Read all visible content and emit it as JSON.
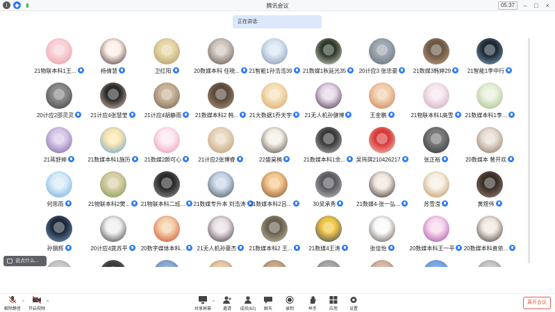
{
  "titlebar": {
    "title": "腾讯会议",
    "time": "05:37",
    "icons": [
      "info-icon",
      "shield-icon",
      "signal-icon"
    ]
  },
  "speaking": {
    "label": "正在讲话:"
  },
  "participants": [
    {
      "name": "21物联本科1王...",
      "c1": "#f9d2d8",
      "c2": "#e69aa6"
    },
    {
      "name": "杨倩慧",
      "c1": "#fdeee6",
      "c2": "#3c2a2a"
    },
    {
      "name": "卫红阳",
      "c1": "#e7d8a8",
      "c2": "#a89060"
    },
    {
      "name": "20数媒本科 任晓...",
      "c1": "#cfc7c0",
      "c2": "#5a4f4a"
    },
    {
      "name": "21智能1孙浩浩39",
      "c1": "#d9e6f2",
      "c2": "#7e8fa8"
    },
    {
      "name": "21数媒1秋延光35",
      "c1": "#2f3a2c",
      "c2": "#d8d8c8"
    },
    {
      "name": "20计应3 张忠豪",
      "c1": "#9ea8b0",
      "c2": "#5f6a72"
    },
    {
      "name": "21数媒3韩婷29",
      "c1": "#6b5846",
      "c2": "#c6a27c"
    },
    {
      "name": "21智能1李中行",
      "c1": "#1e2a36",
      "c2": "#8aa7c0"
    },
    {
      "name": "20计应2邵灵灵",
      "c1": "#8a8a8a",
      "c2": "#3e3e3e"
    },
    {
      "name": "21计应4张慧莹",
      "c1": "#2a2a2a",
      "c2": "#e6c7b6"
    },
    {
      "name": "21计应4胡静雨",
      "c1": "#c9b49a",
      "c2": "#6e5a46"
    },
    {
      "name": "21数媒本科2 韩...",
      "c1": "#5a4a3c",
      "c2": "#b89a7c"
    },
    {
      "name": "21大数据1乔天宇",
      "c1": "#f4e0b8",
      "c2": "#d8a060"
    },
    {
      "name": "21无人机孙健博",
      "c1": "#e6d8e8",
      "c2": "#3a2a3a"
    },
    {
      "name": "王金鹏",
      "c1": "#f2d0b0",
      "c2": "#c97a50"
    },
    {
      "name": "21物联本科1高雪",
      "c1": "#f6e6ee",
      "c2": "#caa0b8"
    },
    {
      "name": "21数媒本科1李...",
      "c1": "#e8f0dc",
      "c2": "#9ab880"
    },
    {
      "name": "21蒋舒婷",
      "c1": "#d8c8e8",
      "c2": "#7860a0"
    },
    {
      "name": "21数媒本科1施历",
      "c1": "#fbe6b0",
      "c2": "#5aa0d8"
    },
    {
      "name": "21数媒2颜可心",
      "c1": "#fbe8f0",
      "c2": "#e890b0"
    },
    {
      "name": "21计应2张博睿",
      "c1": "#e8d8c0",
      "c2": "#b89870"
    },
    {
      "name": "22盛昊楠",
      "c1": "#f4f0e8",
      "c2": "#4a4036"
    },
    {
      "name": "21数媒本科1余...",
      "c1": "#3a3a3a",
      "c2": "#bdbdbd"
    },
    {
      "name": "吴玮琪210426217",
      "c1": "#d83a3a",
      "c2": "#f0d0c0"
    },
    {
      "name": "张正裕",
      "c1": "#7a7a7a",
      "c2": "#2e2e2e"
    },
    {
      "name": "20数媒本 曾开欢",
      "c1": "#e6ddd4",
      "c2": "#8a6e5a"
    },
    {
      "name": "何思雨",
      "c1": "#d8ecf8",
      "c2": "#6aa6d8"
    },
    {
      "name": "21物联本科2樊...",
      "c1": "#d8d0a8",
      "c2": "#7a9048"
    },
    {
      "name": "21物联本科二班...",
      "c1": "#2a2a2a",
      "c2": "#9a9a9a"
    },
    {
      "name": "21数媒专升本 刘浩涛",
      "c1": "#c8d8e8",
      "c2": "#404850"
    },
    {
      "name": "21数媒本科2吕...",
      "c1": "#f4c890",
      "c2": "#7a4a28"
    },
    {
      "name": "30吴承秀",
      "c1": "#5a5a60",
      "c2": "#c0c0c8"
    },
    {
      "name": "21数媒4-张一弘...",
      "c1": "#f0e8e0",
      "c2": "#2a2020"
    },
    {
      "name": "苏雪滢",
      "c1": "#f6f0e4",
      "c2": "#b88850"
    },
    {
      "name": "黄煜伟",
      "c1": "#3a302a",
      "c2": "#a08070"
    },
    {
      "name": "孙钢辉",
      "c1": "#1e2a3a",
      "c2": "#7aa0c8"
    },
    {
      "name": "20计应4龚苏平",
      "c1": "#f0f0f0",
      "c2": "#303030"
    },
    {
      "name": "20数字媒体本科...",
      "c1": "#f4d0a8",
      "c2": "#c8402a"
    },
    {
      "name": "21无人机孙豪杰",
      "c1": "#e8e0e4",
      "c2": "#3a3036"
    },
    {
      "name": "21数媒本科2 王...",
      "c1": "#6a6050",
      "c2": "#c8c0a8"
    },
    {
      "name": "21数媒4王涛",
      "c1": "#f0c848",
      "c2": "#2a3a60"
    },
    {
      "name": "张佳怡",
      "c1": "#fafafa",
      "c2": "#5a4a40"
    },
    {
      "name": "20数媒本科王一平",
      "c1": "#f8d8ec",
      "c2": "#a040a0"
    },
    {
      "name": "20数媒本科袁依...",
      "c1": "#f0e8e0",
      "c2": "#3a3030"
    },
    {
      "name": "",
      "c1": "#c8c8c8",
      "c2": "#888888"
    },
    {
      "name": "",
      "c1": "#3a3a3a",
      "c2": "#888888"
    },
    {
      "name": "",
      "c1": "#8aaad8",
      "c2": "#3a5a8a"
    },
    {
      "name": "",
      "c1": "#e8c8a8",
      "c2": "#8a6a4a"
    },
    {
      "name": "",
      "c1": "#c8a888",
      "c2": "#6a4a2a"
    },
    {
      "name": "",
      "c1": "#a8a8a8",
      "c2": "#5a5a5a"
    },
    {
      "name": "",
      "c1": "#d8b8a8",
      "c2": "#7a5a4a"
    },
    {
      "name": "",
      "c1": "#7aa8e8",
      "c2": "#3a68a8"
    },
    {
      "name": "",
      "c1": "#c8c8c8",
      "c2": "#6a6a6a"
    }
  ],
  "chat": {
    "placeholder": "说点什么..."
  },
  "toolbar": {
    "mute": "解除静音",
    "video": "开启视频",
    "share": "共享屏幕",
    "invite": "邀请",
    "members": "成员(62)",
    "chat": "聊天",
    "record": "录制",
    "raise": "举手",
    "apps": "应用",
    "settings": "设置",
    "leave": "离开会议"
  },
  "colors": {
    "accent": "#2f7bf6",
    "leave": "#e05a47",
    "speaking_bg": "#dbe8fb"
  }
}
